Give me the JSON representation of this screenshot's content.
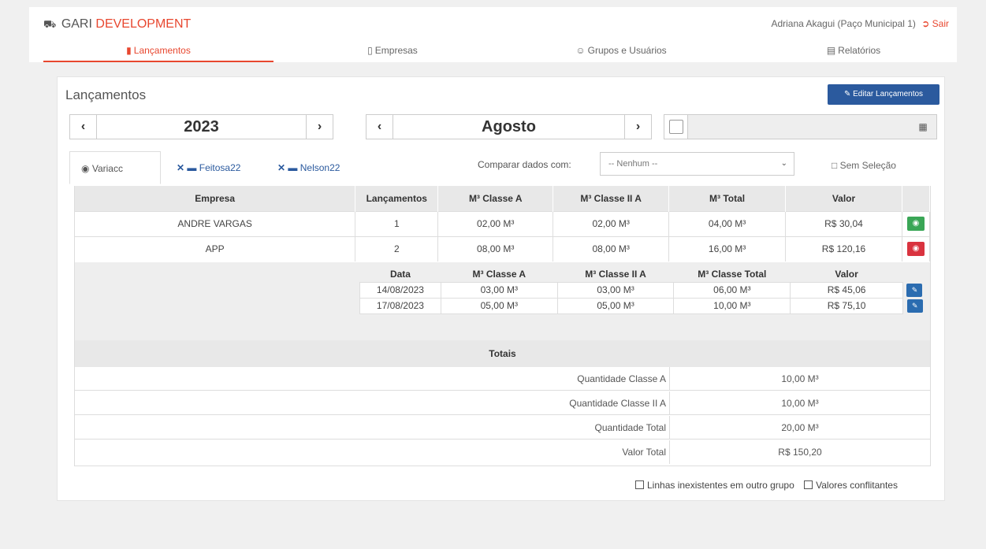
{
  "header": {
    "brand_prefix": "GARI",
    "brand_accent": "DEVELOPMENT",
    "truck_icon": "truck-icon",
    "user": "Adriana Akagui (Paço Municipal 1)",
    "logout": "Sair"
  },
  "nav": {
    "lancamentos": "Lançamentos",
    "empresas": "Empresas",
    "grupos": "Grupos e Usuários",
    "relatorios": "Relatórios"
  },
  "panel": {
    "title": "Lançamentos",
    "edit_button": "Editar Lançamentos",
    "year": "2023",
    "month": "Agosto",
    "date_value": ""
  },
  "subtabs": {
    "tab1": "Variacc",
    "tab2": "Feitosa22",
    "tab3": "Nelson22"
  },
  "compare": {
    "label": "Comparar dados com:",
    "selected": "-- Nenhum --",
    "no_selection": "Sem Seleção"
  },
  "table": {
    "headers": [
      "Empresa",
      "Lançamentos",
      "M³ Classe A",
      "M³ Classe II A",
      "M³ Total",
      "Valor"
    ],
    "rows": [
      {
        "empresa": "ANDRE VARGAS",
        "lanc": "1",
        "a": "02,00 M³",
        "iia": "02,00 M³",
        "total": "04,00 M³",
        "valor": "R$ 30,04"
      },
      {
        "empresa": "APP",
        "lanc": "2",
        "a": "08,00 M³",
        "iia": "08,00 M³",
        "total": "16,00 M³",
        "valor": "R$ 120,16"
      }
    ]
  },
  "detail": {
    "headers": [
      "Data",
      "M³ Classe A",
      "M³ Classe II A",
      "M³ Classe Total",
      "Valor"
    ],
    "rows": [
      {
        "data": "14/08/2023",
        "a": "03,00 M³",
        "iia": "03,00 M³",
        "total": "06,00 M³",
        "valor": "R$ 45,06"
      },
      {
        "data": "17/08/2023",
        "a": "05,00 M³",
        "iia": "05,00 M³",
        "total": "10,00 M³",
        "valor": "R$ 75,10"
      }
    ]
  },
  "totals": {
    "title": "Totais",
    "rows": [
      {
        "label": "Quantidade Classe A",
        "value": "10,00 M³"
      },
      {
        "label": "Quantidade Classe II A",
        "value": "10,00 M³"
      },
      {
        "label": "Quantidade Total",
        "value": "20,00 M³"
      },
      {
        "label": "Valor Total",
        "value": "R$ 150,20"
      }
    ]
  },
  "footer_checks": {
    "c1": "Linhas inexistentes em outro grupo",
    "c2": "Valores conflitantes"
  }
}
